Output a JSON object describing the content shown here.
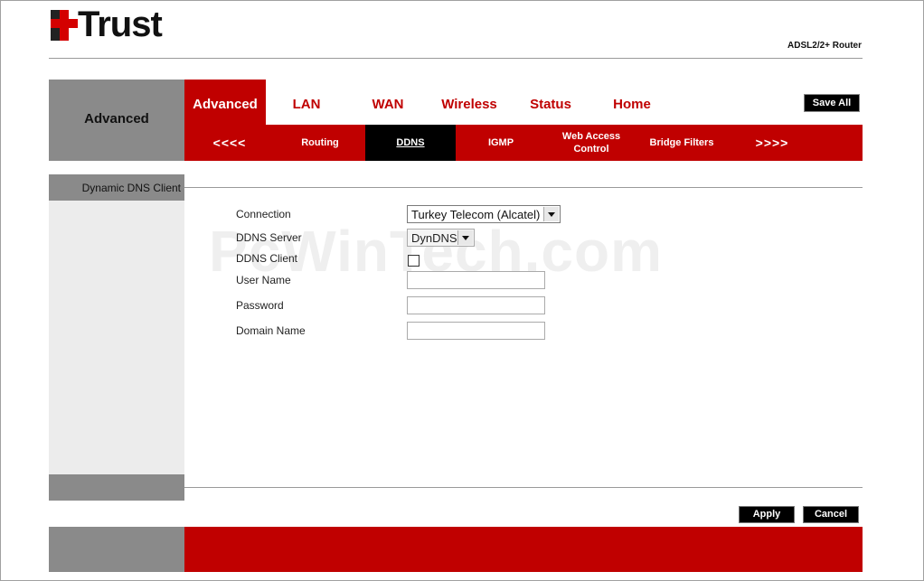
{
  "header": {
    "brand": "Trust",
    "product": "ADSL2/2+ Router"
  },
  "nav": {
    "section_label": "Advanced",
    "tabs": [
      {
        "label": "Advanced",
        "active": true
      },
      {
        "label": "LAN"
      },
      {
        "label": "WAN"
      },
      {
        "label": "Wireless"
      },
      {
        "label": "Status"
      },
      {
        "label": "Home"
      }
    ],
    "save_all": "Save All",
    "subtabs": [
      {
        "label": "<<<<"
      },
      {
        "label": "Routing"
      },
      {
        "label": "DDNS",
        "active": true
      },
      {
        "label": "IGMP"
      },
      {
        "label": "Web Access Control"
      },
      {
        "label": "Bridge Filters"
      },
      {
        "label": ">>>>"
      }
    ]
  },
  "sidebar": {
    "title": "Dynamic DNS Client"
  },
  "watermark": "PcWinTech.com",
  "form": {
    "connection": {
      "label": "Connection",
      "value": "Turkey Telecom (Alcatel)"
    },
    "ddns_server": {
      "label": "DDNS Server",
      "value": "DynDNS"
    },
    "ddns_client": {
      "label": "DDNS Client",
      "checked": false
    },
    "user_name": {
      "label": "User Name",
      "value": ""
    },
    "password": {
      "label": "Password",
      "value": ""
    },
    "domain_name": {
      "label": "Domain Name",
      "value": ""
    }
  },
  "actions": {
    "apply": "Apply",
    "cancel": "Cancel"
  },
  "colors": {
    "brand_red": "#c00000",
    "gray": "#8a8a8a",
    "panel": "#ececec"
  }
}
